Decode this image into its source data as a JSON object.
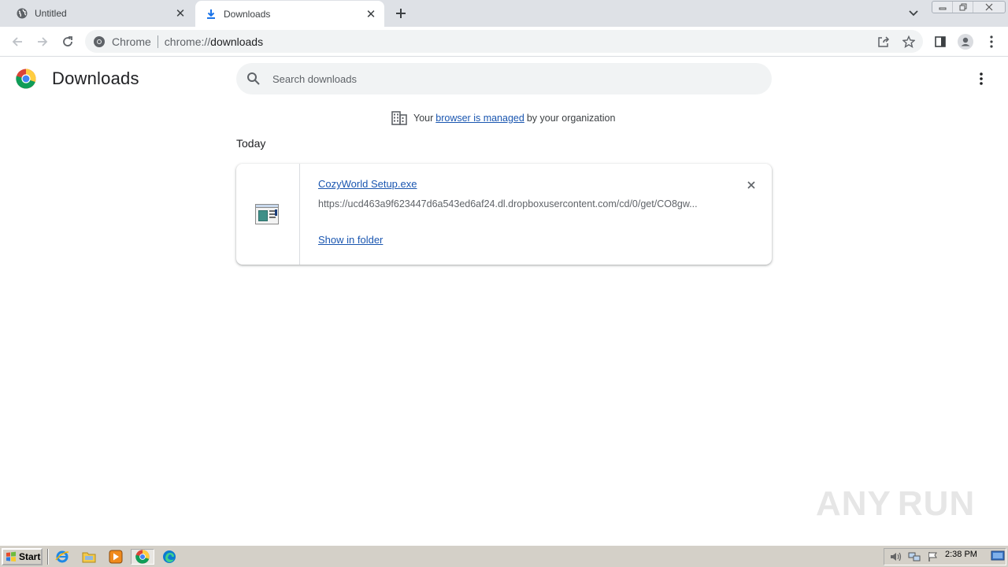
{
  "browser": {
    "tabs": [
      {
        "title": "Untitled",
        "icon": "globe-icon",
        "active": false
      },
      {
        "title": "Downloads",
        "icon": "download-icon",
        "active": true
      }
    ],
    "omnibox": {
      "chip": "Chrome",
      "url_scheme": "chrome://",
      "url_host": "downloads"
    }
  },
  "page": {
    "title": "Downloads",
    "search_placeholder": "Search downloads",
    "managed": {
      "prefix": "Your",
      "link": "browser is managed",
      "suffix": "by your organization"
    },
    "section_date": "Today",
    "downloads": [
      {
        "file_name": "CozyWorld Setup.exe",
        "url": "https://ucd463a9f623447d6a543ed6af24.dl.dropboxusercontent.com/cd/0/get/CO8gw...",
        "action": "Show in folder"
      }
    ]
  },
  "watermark": {
    "left": "ANY",
    "right": "RUN"
  },
  "taskbar": {
    "start_label": "Start",
    "clock": "2:38 PM"
  },
  "colors": {
    "link": "#1a56b0",
    "tabstrip": "#dee1e6",
    "omnibox": "#f1f3f4"
  }
}
